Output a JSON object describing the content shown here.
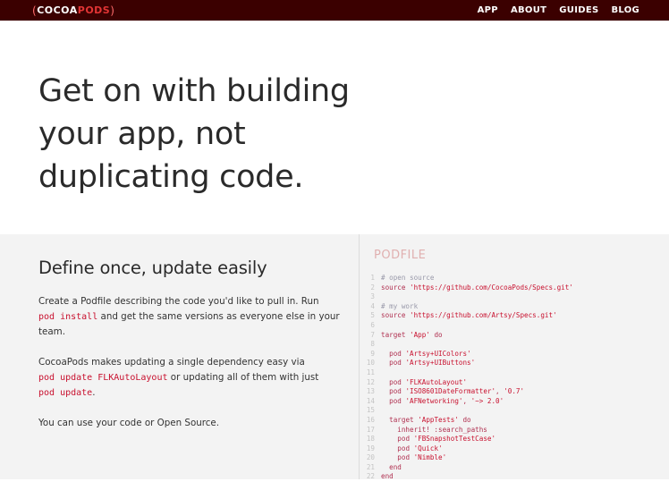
{
  "header": {
    "logo_left_bracket": "(",
    "logo_cocoa": "COCOA",
    "logo_pods": "PODS",
    "logo_right_bracket": ")",
    "nav": [
      "APP",
      "ABOUT",
      "GUIDES",
      "BLOG"
    ]
  },
  "hero": {
    "lines": [
      "Get on with building",
      "your app, not",
      "duplicating code."
    ]
  },
  "feature": {
    "title": "Define once, update easily",
    "p1_a": "Create a Podfile describing the code you'd like to pull in. Run",
    "p1_code": "pod install",
    "p1_b": " and get the same versions as everyone else in your team.",
    "p2_a": "CocoaPods makes updating a single dependency easy via",
    "p2_code1": "pod update FLKAutoLayout",
    "p2_b": " or updating all of them with just",
    "p2_code2": "pod update",
    "p2_c": ".",
    "p3": "You can use your code or Open Source."
  },
  "podfile": {
    "title": "PODFILE",
    "lines": [
      {
        "n": "1",
        "text": "# open source"
      },
      {
        "n": "2",
        "text": "source 'https://github.com/CocoaPods/Specs.git'"
      },
      {
        "n": "3",
        "text": ""
      },
      {
        "n": "4",
        "text": "# my work"
      },
      {
        "n": "5",
        "text": "source 'https://github.com/Artsy/Specs.git'"
      },
      {
        "n": "6",
        "text": ""
      },
      {
        "n": "7",
        "text": "target 'App' do"
      },
      {
        "n": "8",
        "text": ""
      },
      {
        "n": "9",
        "text": "  pod 'Artsy+UIColors'"
      },
      {
        "n": "10",
        "text": "  pod 'Artsy+UIButtons'"
      },
      {
        "n": "11",
        "text": ""
      },
      {
        "n": "12",
        "text": "  pod 'FLKAutoLayout'"
      },
      {
        "n": "13",
        "text": "  pod 'ISO8601DateFormatter', '0.7'"
      },
      {
        "n": "14",
        "text": "  pod 'AFNetworking', '~> 2.0'"
      },
      {
        "n": "15",
        "text": ""
      },
      {
        "n": "16",
        "text": "  target 'AppTests' do"
      },
      {
        "n": "17",
        "text": "    inherit! :search_paths"
      },
      {
        "n": "18",
        "text": "    pod 'FBSnapshotTestCase'"
      },
      {
        "n": "19",
        "text": "    pod 'Quick'"
      },
      {
        "n": "20",
        "text": "    pod 'Nimble'"
      },
      {
        "n": "21",
        "text": "  end"
      },
      {
        "n": "22",
        "text": "end"
      }
    ]
  }
}
